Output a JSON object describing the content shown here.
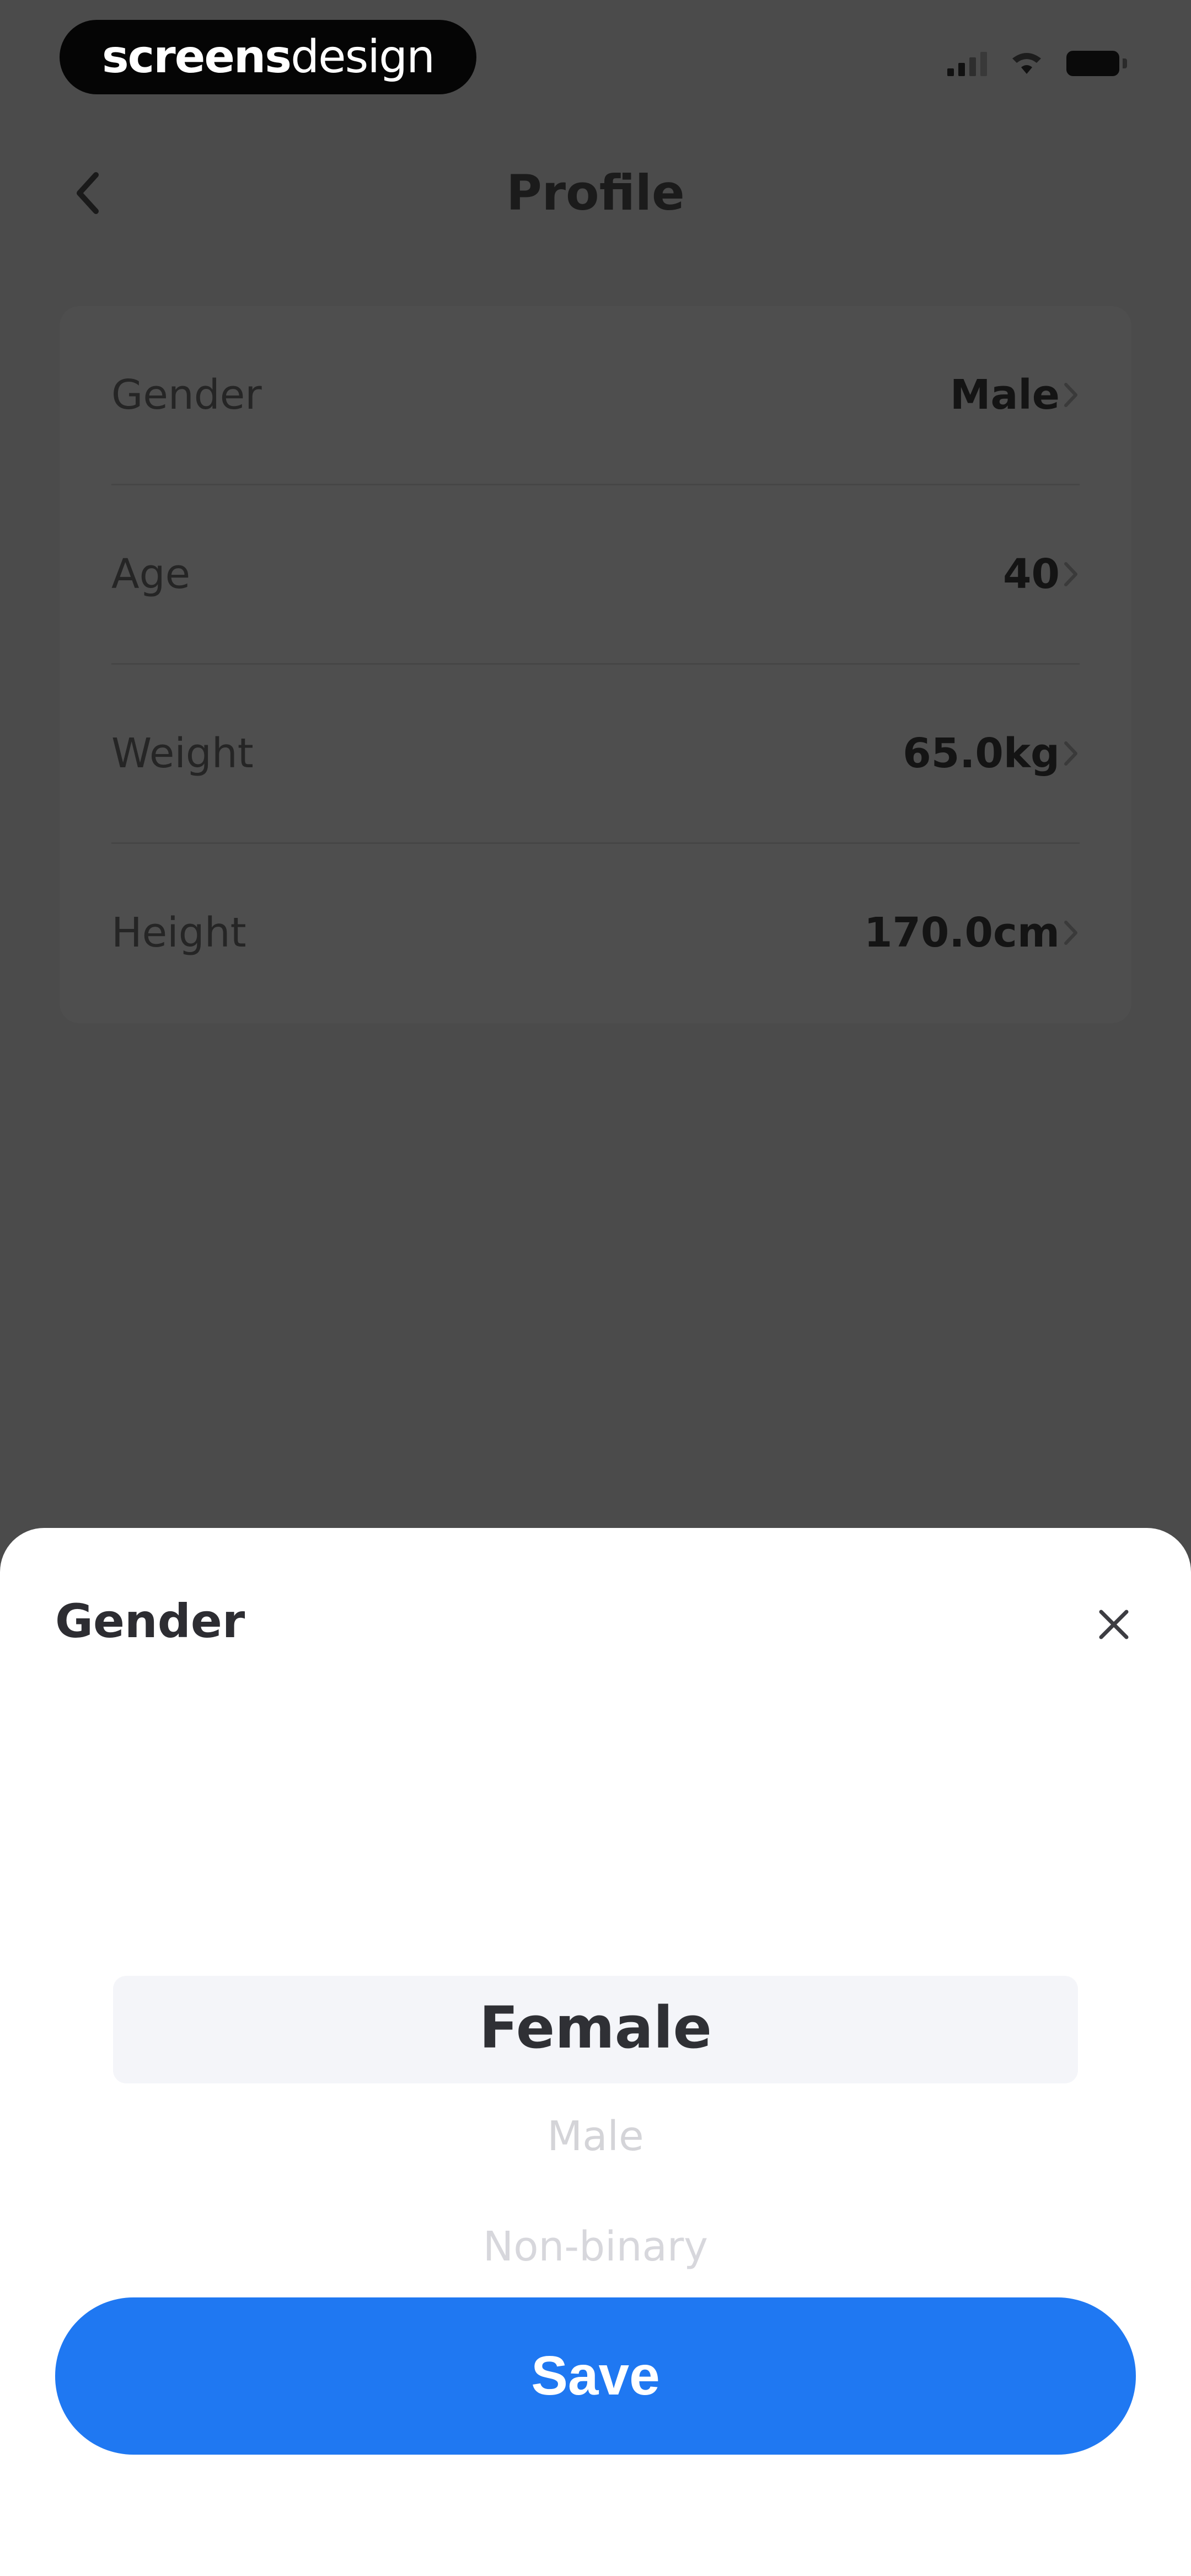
{
  "status_bar": {
    "brand_part1": "screens",
    "brand_part2": "design"
  },
  "header": {
    "title": "Profile"
  },
  "profile": {
    "rows": [
      {
        "label": "Gender",
        "value": "Male"
      },
      {
        "label": "Age",
        "value": "40"
      },
      {
        "label": "Weight",
        "value": "65.0kg"
      },
      {
        "label": "Height",
        "value": "170.0cm"
      }
    ]
  },
  "sheet": {
    "title": "Gender",
    "options": [
      "Female",
      "Male",
      "Non-binary"
    ],
    "selected": "Female",
    "save_label": "Save"
  },
  "colors": {
    "accent": "#1f78f2",
    "overlay": "#4b4b4b",
    "sheet_background": "#ffffff",
    "picker_highlight": "#f4f5f9"
  }
}
